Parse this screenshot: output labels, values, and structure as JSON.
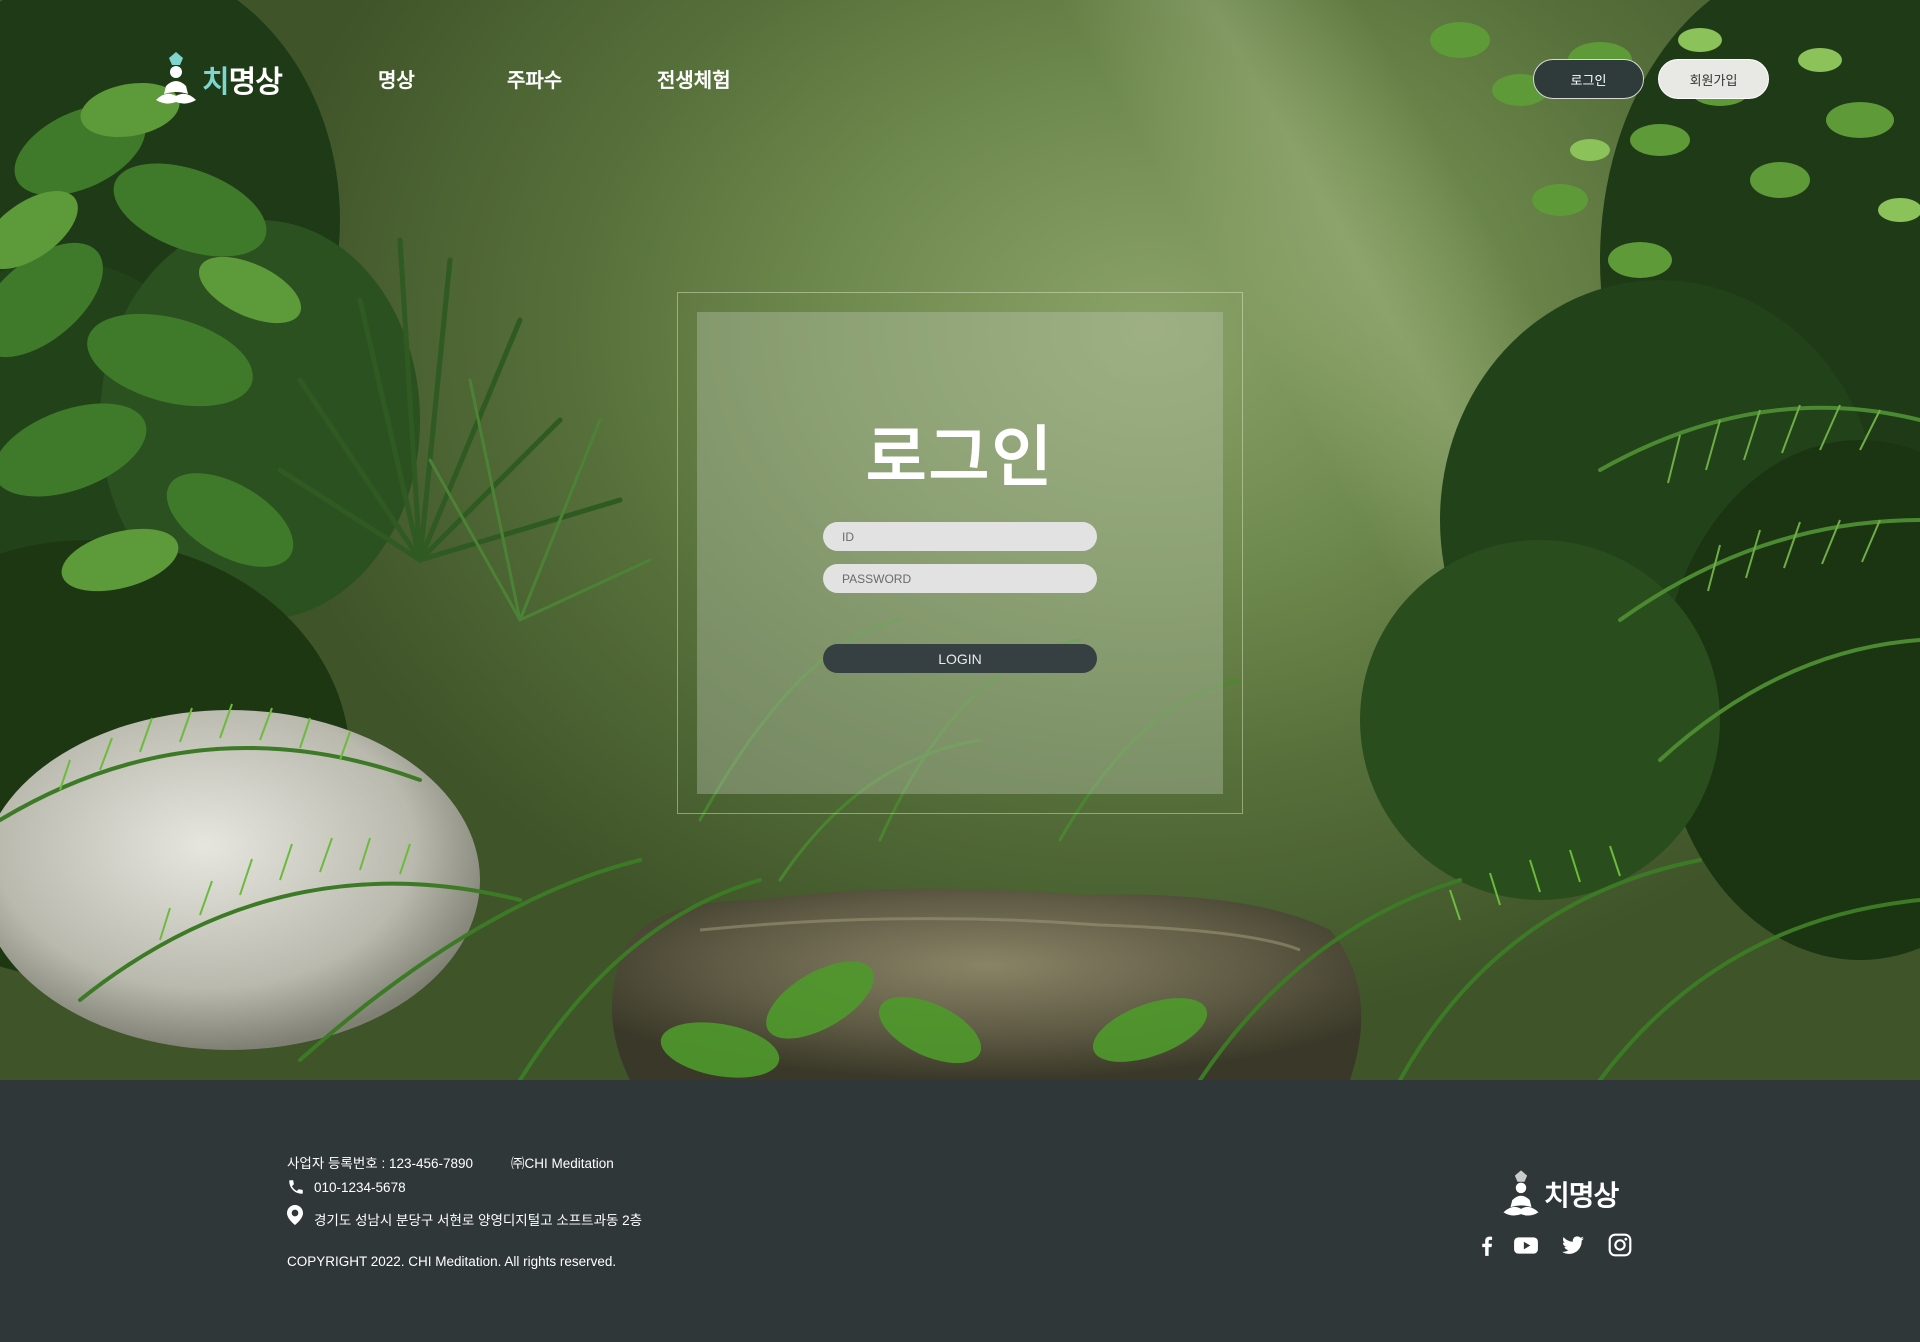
{
  "header": {
    "logo_accent": "치",
    "logo_rest": "명상",
    "nav": [
      {
        "label": "명상"
      },
      {
        "label": "주파수"
      },
      {
        "label": "전생체험"
      }
    ],
    "login_label": "로그인",
    "join_label": "회원가입"
  },
  "login": {
    "title": "로그인",
    "id_placeholder": "ID",
    "password_placeholder": "PASSWORD",
    "submit_label": "LOGIN"
  },
  "footer": {
    "business_number": "사업자 등록번호 : 123-456-7890",
    "company": "㈜CHI Meditation",
    "phone": "010-1234-5678",
    "address": "경기도 성남시 분당구 서현로 양영디지털고 소프트과동 2층",
    "copyright": "COPYRIGHT 2022. CHI Meditation. All rights reserved.",
    "logo_text": "치명상",
    "social": [
      "facebook-icon",
      "youtube-icon",
      "twitter-icon",
      "instagram-icon"
    ]
  },
  "colors": {
    "logo_accent": "#7fd6d0",
    "footer_bg": "#303739",
    "button_dark": "#363f41",
    "field_bg": "#e2e2e2"
  }
}
